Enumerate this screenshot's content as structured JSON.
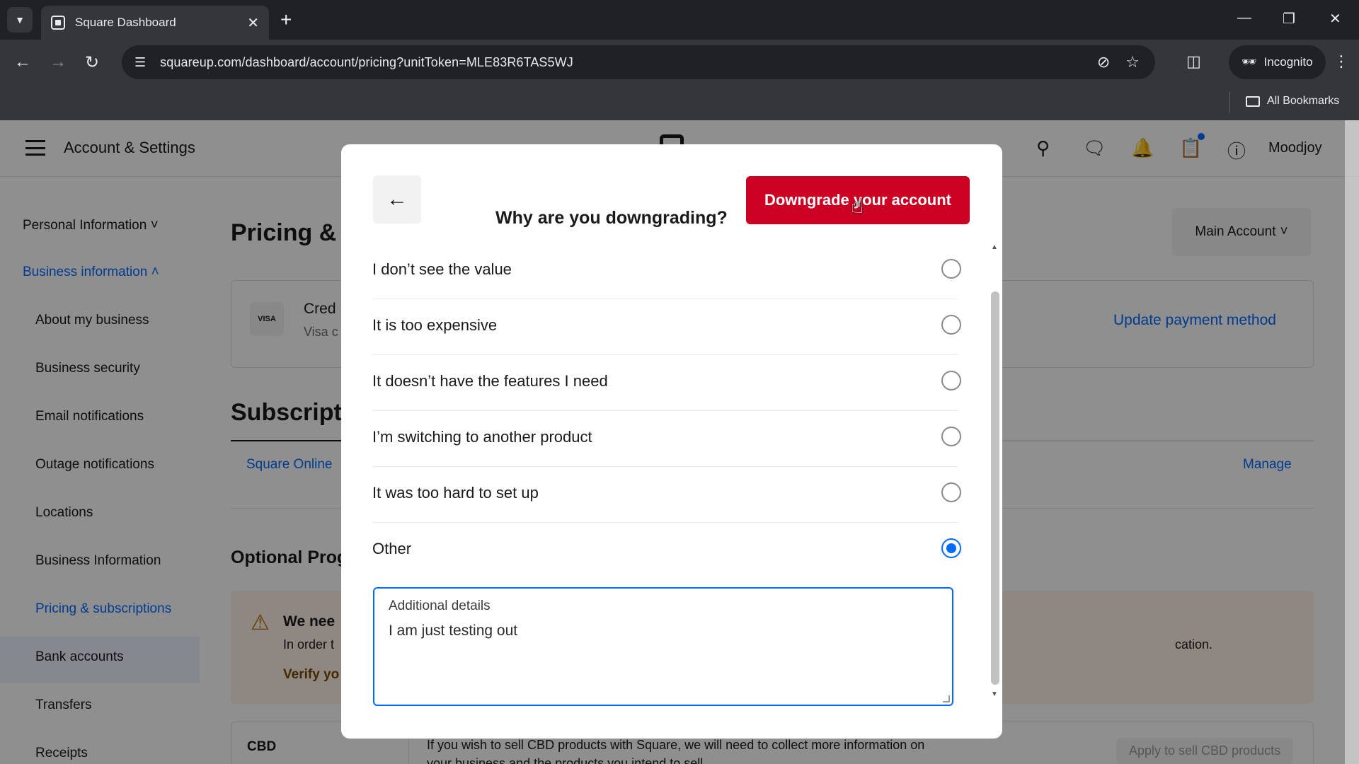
{
  "browser": {
    "tab_title": "Square Dashboard",
    "new_tab_icon": "plus-icon",
    "url": "squareup.com/dashboard/account/pricing?unitToken=MLE83R6TAS5WJ",
    "incognito_label": "Incognito",
    "all_bookmarks_label": "All Bookmarks"
  },
  "header": {
    "title": "Account & Settings",
    "user_name": "Moodjoy"
  },
  "sidebar": {
    "personal_information": "Personal Information",
    "business_information": "Business information",
    "items": [
      "About my business",
      "Business security",
      "Email notifications",
      "Outage notifications",
      "Locations",
      "Business Information",
      "Pricing & subscriptions",
      "Bank accounts",
      "Transfers",
      "Receipts"
    ]
  },
  "main": {
    "pricing_heading": "Pricing & S",
    "card_title": "Cred",
    "card_subtitle": "Visa c",
    "visa_label": "VISA",
    "update_payment": "Update payment method",
    "account_select": "Main Account",
    "subscriptions_heading": "Subscript",
    "square_online": "Square Online",
    "manage": "Manage",
    "optional_heading": "Optional Prog",
    "warning_title": "We nee",
    "warning_text": "In order t",
    "warning_tail": "cation.",
    "verify": "Verify yo",
    "cbd_label": "CBD",
    "cbd_text_1": "If you wish to sell CBD products with Square, we will need to collect more information on",
    "cbd_text_2": "your business and the products you intend to sell.",
    "cbd_button": "Apply to sell CBD products"
  },
  "modal": {
    "title": "Why are you downgrading?",
    "primary_button": "Downgrade your account",
    "options": [
      {
        "label": "I don’t see the value",
        "checked": false
      },
      {
        "label": "It is too expensive",
        "checked": false
      },
      {
        "label": "It doesn’t have the features I need",
        "checked": false
      },
      {
        "label": "I’m switching to another product",
        "checked": false
      },
      {
        "label": "It was too hard to set up",
        "checked": false
      },
      {
        "label": "Other",
        "checked": true
      }
    ],
    "details_label": "Additional details",
    "details_value": "I am just testing out"
  },
  "colors": {
    "accent_blue": "#006aff",
    "danger_red": "#cc0023"
  }
}
